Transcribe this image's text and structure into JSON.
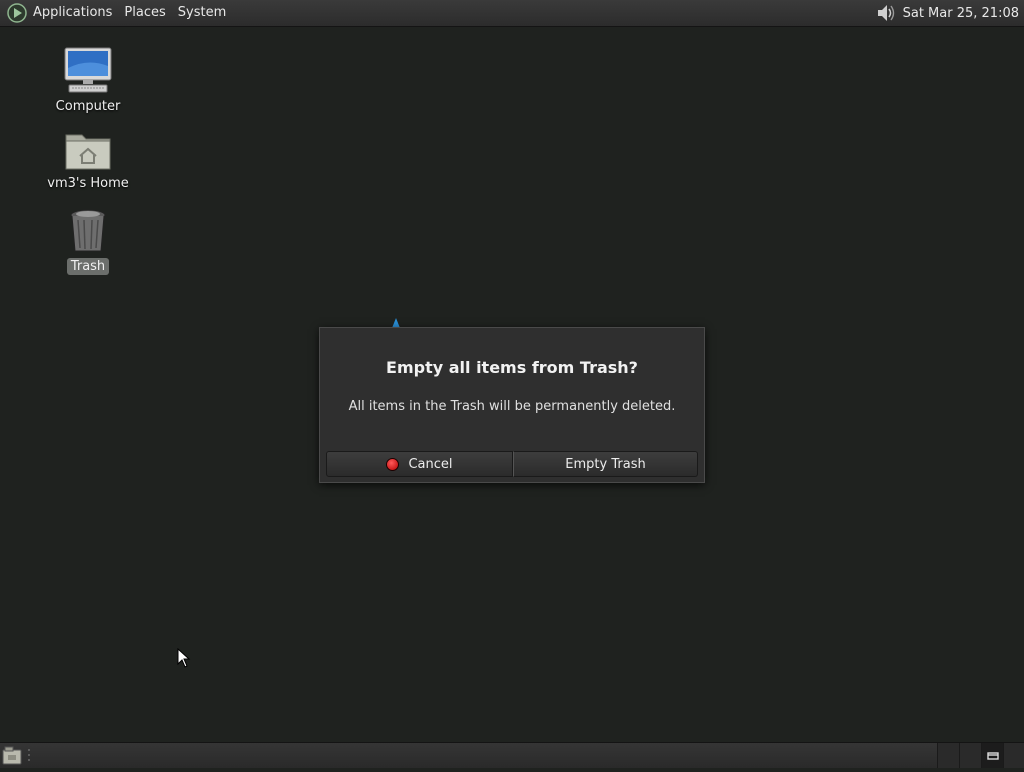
{
  "top_panel": {
    "menus": [
      "Applications",
      "Places",
      "System"
    ],
    "clock": "Sat Mar 25, 21:08"
  },
  "desktop": {
    "icons": [
      {
        "label": "Computer",
        "icon": "computer-icon"
      },
      {
        "label": "vm3's Home",
        "icon": "home-folder-icon"
      },
      {
        "label": "Trash",
        "icon": "trash-icon",
        "selected": true
      }
    ]
  },
  "dialog": {
    "title": "Empty all items from Trash?",
    "message": "All items in the Trash will be permanently deleted.",
    "cancel_label": "Cancel",
    "confirm_label": "Empty Trash"
  },
  "colors": {
    "desktop_bg": "#1f221f",
    "dialog_bg": "#2f2f2f",
    "cancel_icon": "#d40000"
  }
}
